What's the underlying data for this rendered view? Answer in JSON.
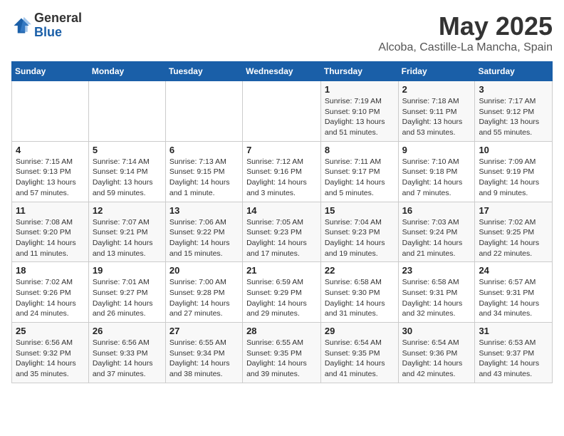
{
  "logo": {
    "general": "General",
    "blue": "Blue"
  },
  "title": "May 2025",
  "subtitle": "Alcoba, Castille-La Mancha, Spain",
  "days_of_week": [
    "Sunday",
    "Monday",
    "Tuesday",
    "Wednesday",
    "Thursday",
    "Friday",
    "Saturday"
  ],
  "weeks": [
    [
      {
        "day": "",
        "info": ""
      },
      {
        "day": "",
        "info": ""
      },
      {
        "day": "",
        "info": ""
      },
      {
        "day": "",
        "info": ""
      },
      {
        "day": "1",
        "info": "Sunrise: 7:19 AM\nSunset: 9:10 PM\nDaylight: 13 hours and 51 minutes."
      },
      {
        "day": "2",
        "info": "Sunrise: 7:18 AM\nSunset: 9:11 PM\nDaylight: 13 hours and 53 minutes."
      },
      {
        "day": "3",
        "info": "Sunrise: 7:17 AM\nSunset: 9:12 PM\nDaylight: 13 hours and 55 minutes."
      }
    ],
    [
      {
        "day": "4",
        "info": "Sunrise: 7:15 AM\nSunset: 9:13 PM\nDaylight: 13 hours and 57 minutes."
      },
      {
        "day": "5",
        "info": "Sunrise: 7:14 AM\nSunset: 9:14 PM\nDaylight: 13 hours and 59 minutes."
      },
      {
        "day": "6",
        "info": "Sunrise: 7:13 AM\nSunset: 9:15 PM\nDaylight: 14 hours and 1 minute."
      },
      {
        "day": "7",
        "info": "Sunrise: 7:12 AM\nSunset: 9:16 PM\nDaylight: 14 hours and 3 minutes."
      },
      {
        "day": "8",
        "info": "Sunrise: 7:11 AM\nSunset: 9:17 PM\nDaylight: 14 hours and 5 minutes."
      },
      {
        "day": "9",
        "info": "Sunrise: 7:10 AM\nSunset: 9:18 PM\nDaylight: 14 hours and 7 minutes."
      },
      {
        "day": "10",
        "info": "Sunrise: 7:09 AM\nSunset: 9:19 PM\nDaylight: 14 hours and 9 minutes."
      }
    ],
    [
      {
        "day": "11",
        "info": "Sunrise: 7:08 AM\nSunset: 9:20 PM\nDaylight: 14 hours and 11 minutes."
      },
      {
        "day": "12",
        "info": "Sunrise: 7:07 AM\nSunset: 9:21 PM\nDaylight: 14 hours and 13 minutes."
      },
      {
        "day": "13",
        "info": "Sunrise: 7:06 AM\nSunset: 9:22 PM\nDaylight: 14 hours and 15 minutes."
      },
      {
        "day": "14",
        "info": "Sunrise: 7:05 AM\nSunset: 9:23 PM\nDaylight: 14 hours and 17 minutes."
      },
      {
        "day": "15",
        "info": "Sunrise: 7:04 AM\nSunset: 9:23 PM\nDaylight: 14 hours and 19 minutes."
      },
      {
        "day": "16",
        "info": "Sunrise: 7:03 AM\nSunset: 9:24 PM\nDaylight: 14 hours and 21 minutes."
      },
      {
        "day": "17",
        "info": "Sunrise: 7:02 AM\nSunset: 9:25 PM\nDaylight: 14 hours and 22 minutes."
      }
    ],
    [
      {
        "day": "18",
        "info": "Sunrise: 7:02 AM\nSunset: 9:26 PM\nDaylight: 14 hours and 24 minutes."
      },
      {
        "day": "19",
        "info": "Sunrise: 7:01 AM\nSunset: 9:27 PM\nDaylight: 14 hours and 26 minutes."
      },
      {
        "day": "20",
        "info": "Sunrise: 7:00 AM\nSunset: 9:28 PM\nDaylight: 14 hours and 27 minutes."
      },
      {
        "day": "21",
        "info": "Sunrise: 6:59 AM\nSunset: 9:29 PM\nDaylight: 14 hours and 29 minutes."
      },
      {
        "day": "22",
        "info": "Sunrise: 6:58 AM\nSunset: 9:30 PM\nDaylight: 14 hours and 31 minutes."
      },
      {
        "day": "23",
        "info": "Sunrise: 6:58 AM\nSunset: 9:31 PM\nDaylight: 14 hours and 32 minutes."
      },
      {
        "day": "24",
        "info": "Sunrise: 6:57 AM\nSunset: 9:31 PM\nDaylight: 14 hours and 34 minutes."
      }
    ],
    [
      {
        "day": "25",
        "info": "Sunrise: 6:56 AM\nSunset: 9:32 PM\nDaylight: 14 hours and 35 minutes."
      },
      {
        "day": "26",
        "info": "Sunrise: 6:56 AM\nSunset: 9:33 PM\nDaylight: 14 hours and 37 minutes."
      },
      {
        "day": "27",
        "info": "Sunrise: 6:55 AM\nSunset: 9:34 PM\nDaylight: 14 hours and 38 minutes."
      },
      {
        "day": "28",
        "info": "Sunrise: 6:55 AM\nSunset: 9:35 PM\nDaylight: 14 hours and 39 minutes."
      },
      {
        "day": "29",
        "info": "Sunrise: 6:54 AM\nSunset: 9:35 PM\nDaylight: 14 hours and 41 minutes."
      },
      {
        "day": "30",
        "info": "Sunrise: 6:54 AM\nSunset: 9:36 PM\nDaylight: 14 hours and 42 minutes."
      },
      {
        "day": "31",
        "info": "Sunrise: 6:53 AM\nSunset: 9:37 PM\nDaylight: 14 hours and 43 minutes."
      }
    ]
  ]
}
